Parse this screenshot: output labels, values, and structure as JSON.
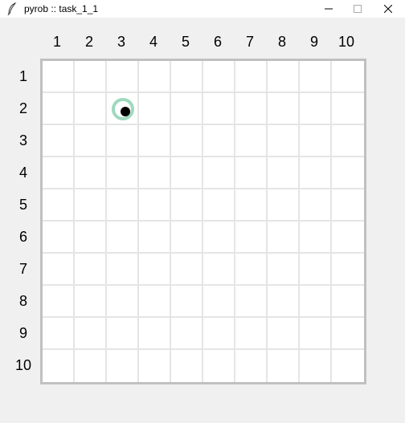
{
  "window": {
    "title": "pyrob :: task_1_1",
    "icon": "feather-icon"
  },
  "controls": {
    "minimize_icon": "minimize-icon",
    "maximize_icon": "maximize-icon",
    "close_icon": "close-icon"
  },
  "grid": {
    "columns": [
      "1",
      "2",
      "3",
      "4",
      "5",
      "6",
      "7",
      "8",
      "9",
      "10"
    ],
    "rows": [
      "1",
      "2",
      "3",
      "4",
      "5",
      "6",
      "7",
      "8",
      "9",
      "10"
    ]
  },
  "robot": {
    "row": 2,
    "col": 3,
    "ring_color": "#9ed9bf",
    "dot_color": "#000000"
  },
  "colors": {
    "board_border": "#c0c0c0",
    "grid_line": "#e5e5e5",
    "background": "#f0f0f0"
  }
}
